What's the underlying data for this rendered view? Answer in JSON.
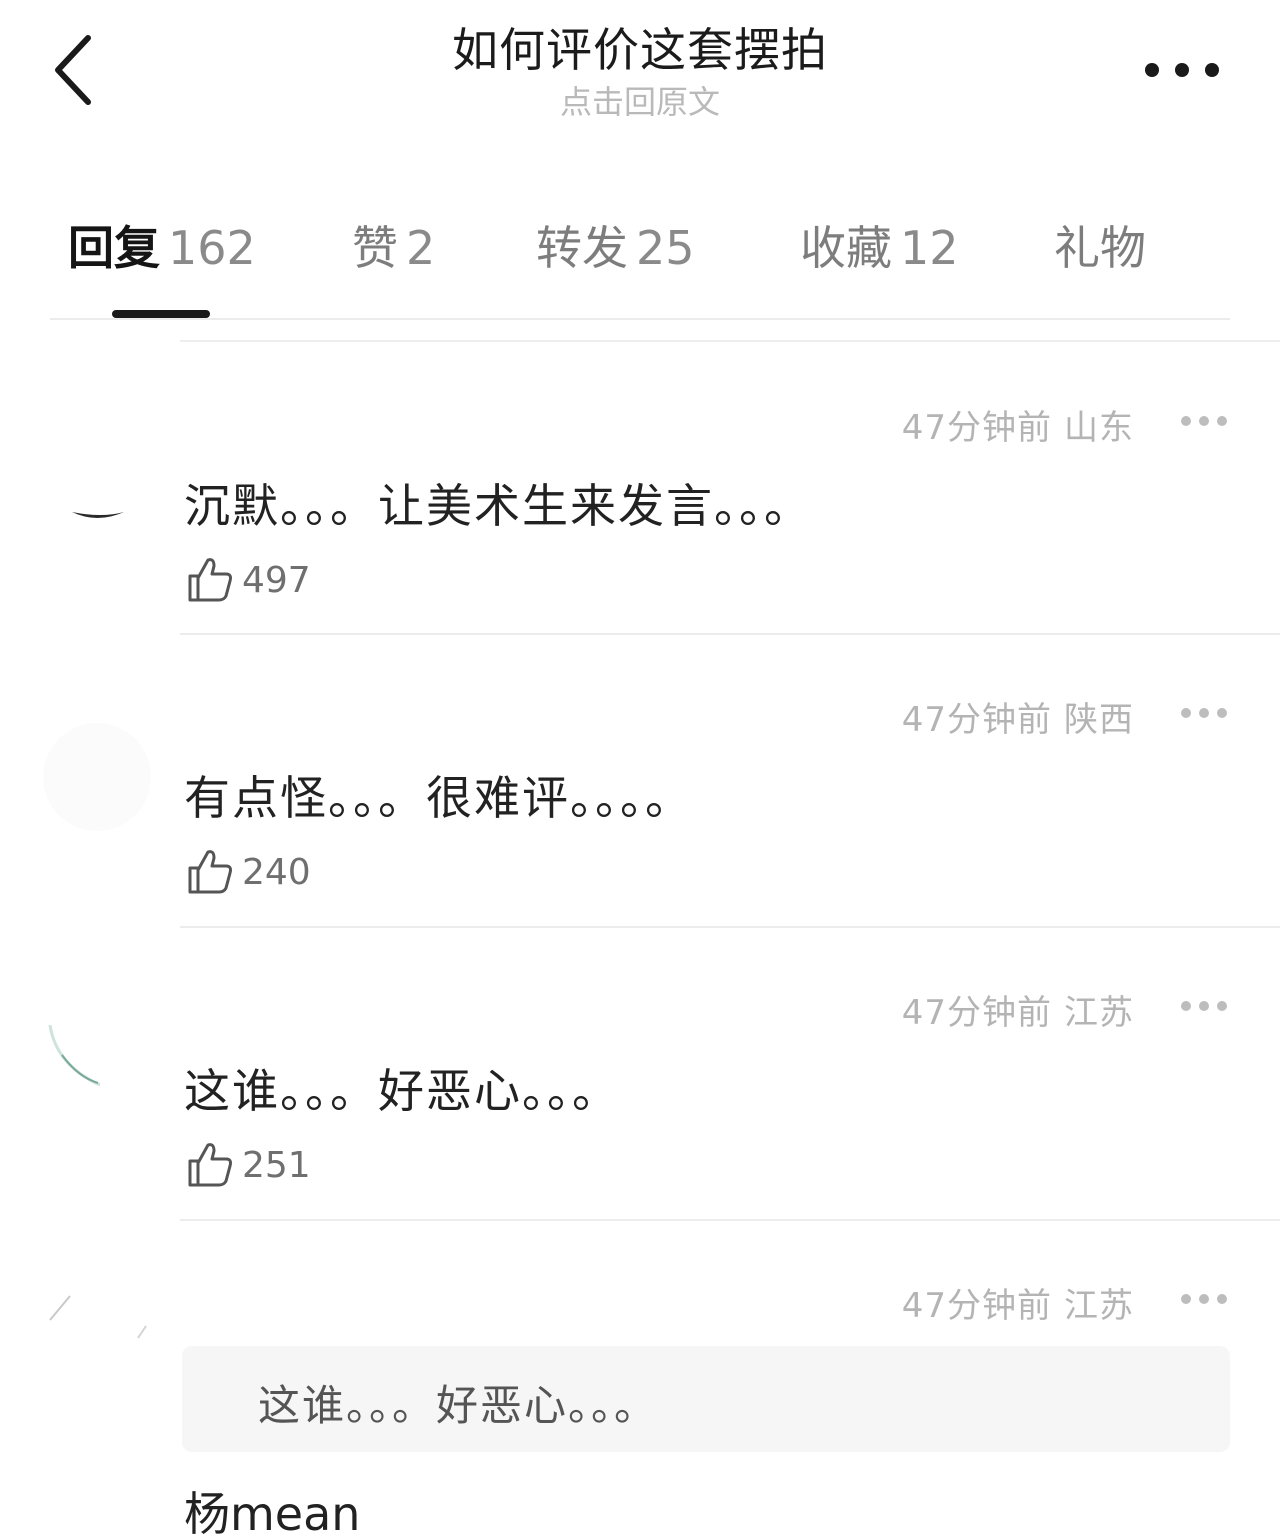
{
  "header": {
    "title": "如何评价这套摆拍",
    "subtitle": "点击回原文"
  },
  "tabs": [
    {
      "label": "回复",
      "count": "162",
      "active": true
    },
    {
      "label": "赞",
      "count": "2",
      "active": false
    },
    {
      "label": "转发",
      "count": "25",
      "active": false
    },
    {
      "label": "收藏",
      "count": "12",
      "active": false
    },
    {
      "label": "礼物",
      "count": "",
      "active": false
    }
  ],
  "comments": [
    {
      "time": "47分钟前",
      "location": "山东",
      "text": "沉默。。。让美术生来发言。。。",
      "likes": "497"
    },
    {
      "time": "47分钟前",
      "location": "陕西",
      "text": "有点怪。。。很难评。。。。",
      "likes": "240"
    },
    {
      "time": "47分钟前",
      "location": "江苏",
      "text": "这谁。。。好恶心。。。",
      "likes": "251"
    },
    {
      "time": "47分钟前",
      "location": "江苏",
      "quote": "这谁。。。好恶心。。。",
      "text": "杨mean"
    }
  ],
  "colors": {
    "title": "#1b1b1b",
    "muted": "#b4b4b4",
    "tab_active": "#151515",
    "divider": "#ececec",
    "quote_bg": "#f6f6f6"
  },
  "icons": {
    "back": "chevron-left-icon",
    "more": "more-dots-icon",
    "like": "thumbs-up-icon"
  }
}
